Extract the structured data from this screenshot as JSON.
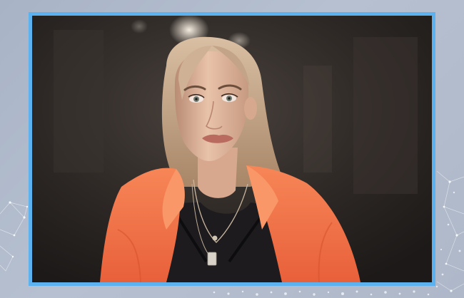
{
  "page": {
    "background_color": "#b0bacb",
    "frame_border_color": "#5cb1ef",
    "network_color": "#ffffff"
  },
  "photo": {
    "subject_colors": {
      "hair": "#c8a98c",
      "skin": "#e3b79f",
      "jacket": "#f3734a",
      "top": "#1d1b1e",
      "background": "#2a2624"
    }
  }
}
